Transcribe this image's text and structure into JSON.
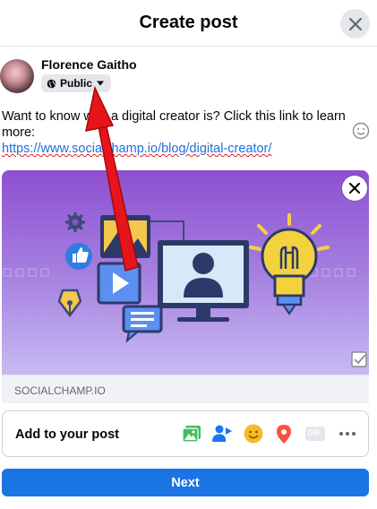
{
  "header": {
    "title": "Create post",
    "close_icon": "close-icon"
  },
  "author": {
    "name": "Florence Gaitho",
    "audience_label": "Public",
    "audience_icon": "globe-icon"
  },
  "post": {
    "text": "Want to know who a digital creator is? Click this link to learn more:",
    "link": "https://www.socialchamp.io/blog/digital-creator/"
  },
  "link_preview": {
    "domain": "SOCIALCHAMP.IO"
  },
  "add_to_post": {
    "label": "Add to your post",
    "icons": [
      "photo-video-icon",
      "tag-people-icon",
      "feeling-icon",
      "check-in-icon",
      "gif-icon",
      "more-icon"
    ],
    "gif_label": "GIF"
  },
  "footer": {
    "next_label": "Next"
  },
  "colors": {
    "primary": "#1b74e4",
    "link": "#216fdb",
    "preview_top": "#8e4fd0",
    "annotation_arrow": "#e8141b"
  }
}
